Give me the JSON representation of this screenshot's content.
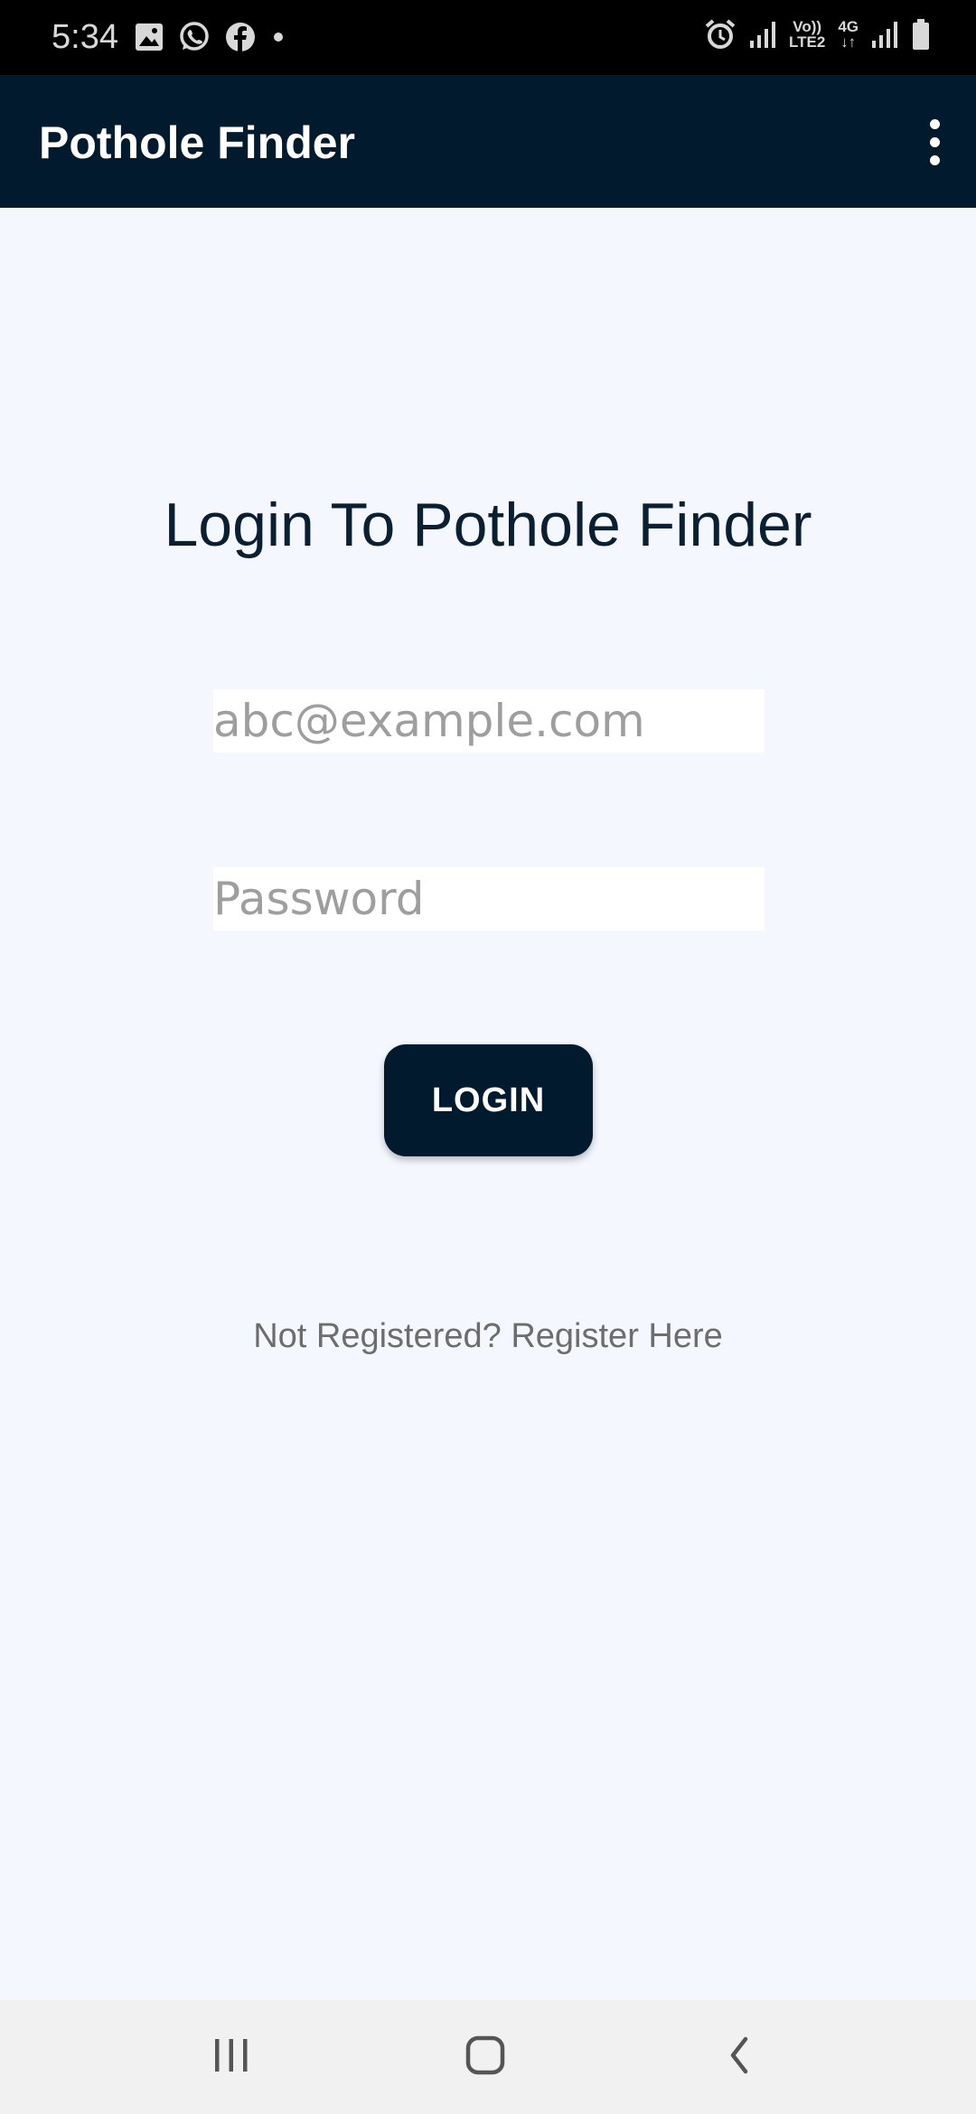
{
  "status_bar": {
    "time": "5:34",
    "network_label_1_top": "Vo))",
    "network_label_1_bottom": "LTE2",
    "network_label_2_top": "4G",
    "network_label_2_bottom": "↓↑"
  },
  "app_bar": {
    "title": "Pothole Finder"
  },
  "login": {
    "heading": "Login To Pothole Finder",
    "email_placeholder": "abc@example.com",
    "email_value": "",
    "password_placeholder": "Password",
    "password_value": "",
    "button_label": "LOGIN",
    "register_link": "Not Registered? Register Here"
  },
  "colors": {
    "app_bar": "#021a2e",
    "background": "#f4f7fe",
    "button": "#021a2e",
    "heading_text": "#0b1f33",
    "link_text": "#6d6d6d",
    "placeholder_text": "#9e9e9e"
  },
  "icons": {
    "status_left": [
      "gallery-icon",
      "whatsapp-icon",
      "facebook-icon",
      "notification-dot-icon"
    ],
    "status_right": [
      "alarm-icon",
      "signal-icon",
      "signal-icon",
      "battery-icon"
    ],
    "app_bar": [
      "overflow-menu-icon"
    ],
    "nav": [
      "recent-apps-icon",
      "home-icon",
      "back-icon"
    ]
  }
}
